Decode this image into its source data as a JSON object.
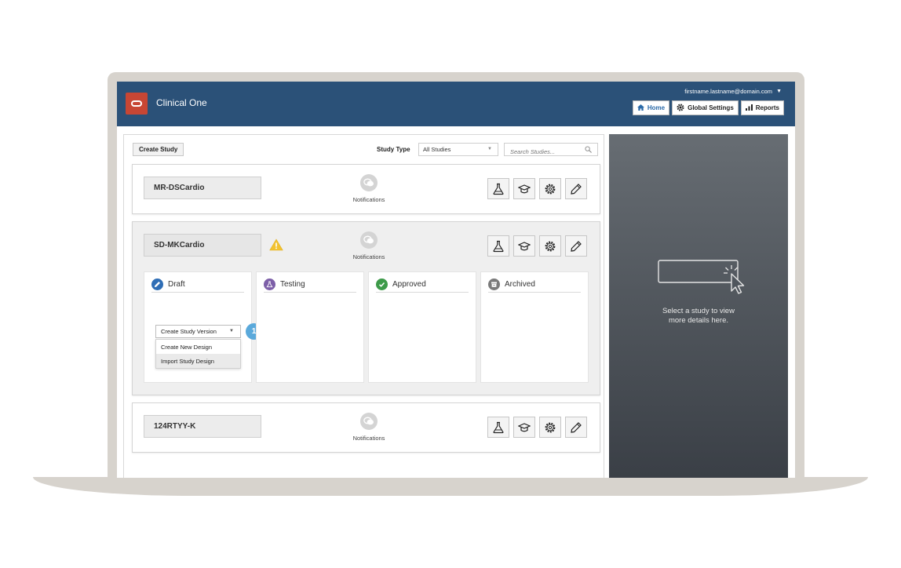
{
  "header": {
    "app_title": "Clinical One",
    "user_email": "firstname.lastname@domain.com",
    "nav": {
      "home": "Home",
      "global_settings": "Global Settings",
      "reports": "Reports"
    }
  },
  "toolbar": {
    "create_study": "Create Study",
    "study_type_label": "Study Type",
    "study_type_value": "All Studies",
    "search_placeholder": "Search Studies..."
  },
  "studies": [
    {
      "name": "MR-DSCardio",
      "notifications_label": "Notifications",
      "warning": false
    },
    {
      "name": "SD-MKCardio",
      "notifications_label": "Notifications",
      "warning": true
    },
    {
      "name": "124RTYY-K",
      "notifications_label": "Notifications",
      "warning": false
    }
  ],
  "version_columns": [
    {
      "label": "Draft",
      "icon": "pencil-icon",
      "color": "#2f6eb6"
    },
    {
      "label": "Testing",
      "icon": "flask-icon",
      "color": "#7d5fa8"
    },
    {
      "label": "Approved",
      "icon": "check-icon",
      "color": "#3d9a49"
    },
    {
      "label": "Archived",
      "icon": "archive-icon",
      "color": "#7a7a7a"
    }
  ],
  "version_dropdown": {
    "label": "Create Study Version",
    "options": [
      "Create New Design",
      "Import Study Design"
    ],
    "step_number": "1"
  },
  "detail_panel": {
    "hint_line1": "Select a study to view",
    "hint_line2": "more details here."
  },
  "colors": {
    "header_bg": "#2b5178",
    "brand_red": "#c74634",
    "step_badge": "#5aa9db",
    "warning": "#f2c230"
  }
}
